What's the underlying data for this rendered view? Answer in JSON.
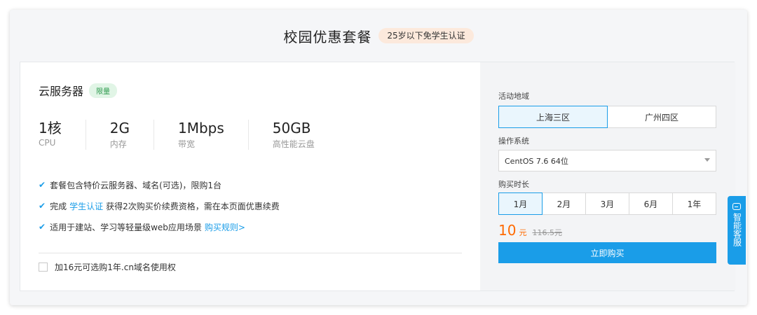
{
  "header": {
    "title": "校园优惠套餐",
    "badge": "25岁以下免学生认证"
  },
  "product": {
    "name": "云服务器",
    "badge": "限量",
    "specs": [
      {
        "value": "1核",
        "label": "CPU"
      },
      {
        "value": "2G",
        "label": "内存"
      },
      {
        "value": "1Mbps",
        "label": "带宽"
      },
      {
        "value": "50GB",
        "label": "高性能云盘"
      }
    ],
    "features": {
      "f1": "套餐包含特价云服务器、域名(可选)，限购1台",
      "f2_pre": "完成",
      "f2_link": "学生认证",
      "f2_post": "获得2次购买价续费资格，需在本页面优惠续费",
      "f3_pre": "适用于建站、学习等轻量级web应用场景",
      "f3_link": "购买规则>"
    },
    "addon": "加16元可选购1年.cn域名使用权"
  },
  "config": {
    "region_label": "活动地域",
    "regions": [
      "上海三区",
      "广州四区"
    ],
    "os_label": "操作系统",
    "os_value": "CentOS 7.6 64位",
    "duration_label": "购买时长",
    "durations": [
      "1月",
      "2月",
      "3月",
      "6月",
      "1年"
    ],
    "price_now": "10",
    "price_unit": "元",
    "price_old": "116.5元",
    "buy_label": "立即购买"
  },
  "service": {
    "label": "智能客服"
  },
  "colors": {
    "accent": "#1a9de8",
    "price": "#ff6a00",
    "limit_badge": "#2e9a4e"
  }
}
